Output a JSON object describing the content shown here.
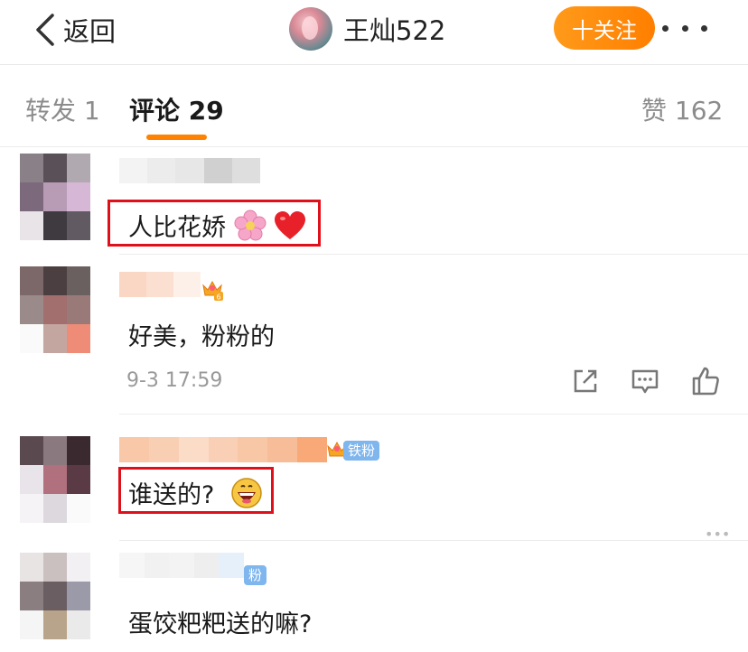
{
  "header": {
    "back_label": "返回",
    "profile_name": "王灿522",
    "follow_label": "十关注"
  },
  "tabs": {
    "repost": "转发 1",
    "comment": "评论 29",
    "like": "赞 162"
  },
  "comments": [
    {
      "text": "人比花娇"
    },
    {
      "text": "好美，粉粉的",
      "timestamp": "9-3 17:59",
      "level_badge": "6"
    },
    {
      "text": "谁送的?",
      "fan_badge": "铁粉"
    },
    {
      "text": "蛋饺粑粑送的嘛?",
      "fan_badge": "粉"
    }
  ],
  "colors": {
    "accent": "#ff8200",
    "highlight_border": "#e0101a",
    "fan_badge": "#7fb6ee"
  }
}
